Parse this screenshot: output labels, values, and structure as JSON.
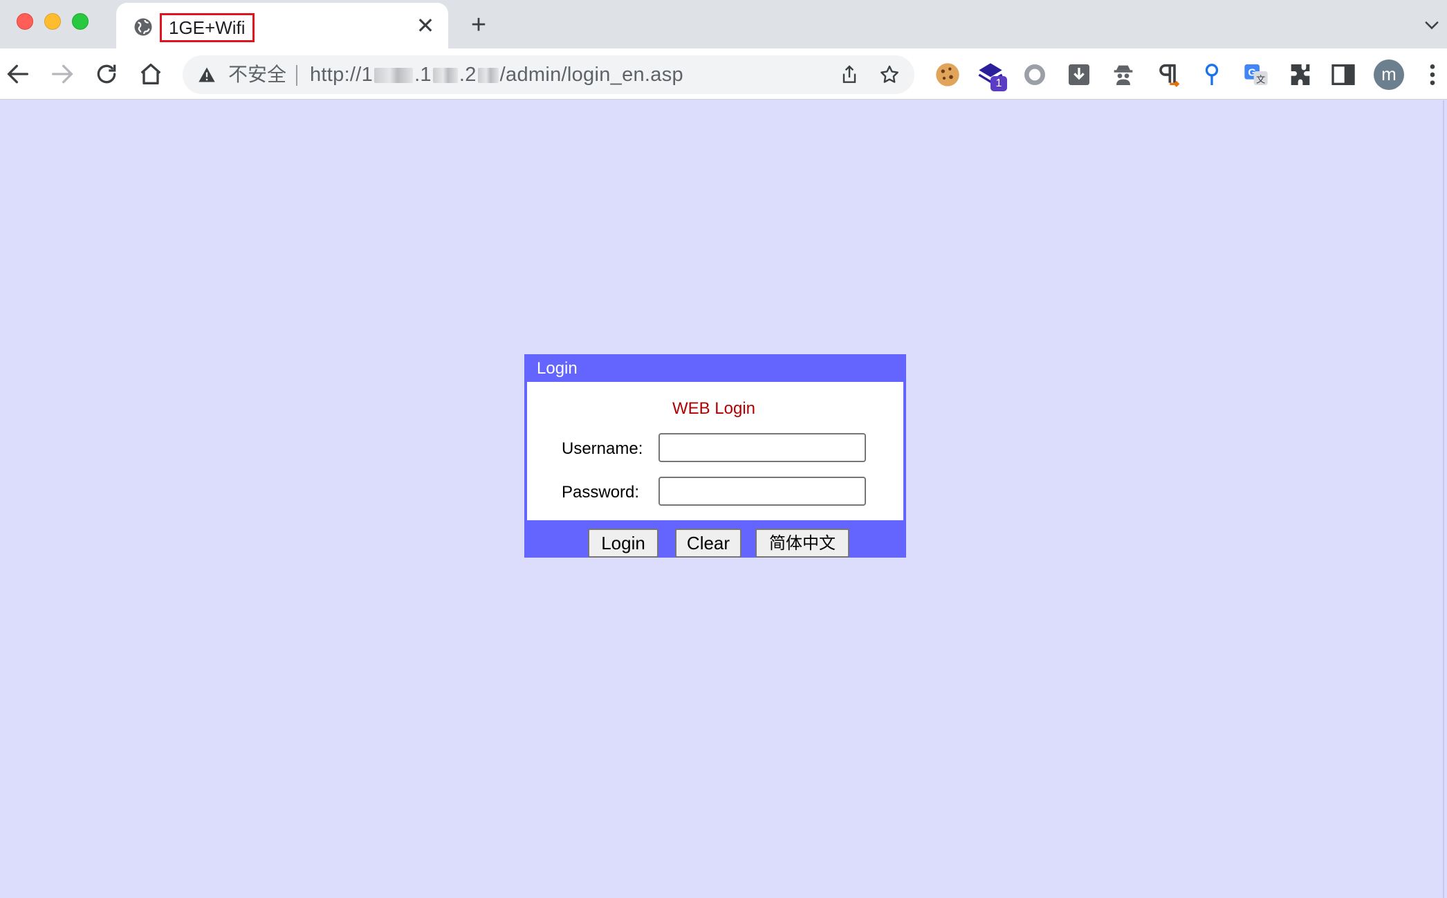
{
  "browser": {
    "tab": {
      "title": "1GE+Wifi",
      "close_glyph": "✕"
    },
    "new_tab_glyph": "+",
    "omnibox": {
      "security_label": "不安全",
      "url_prefix": "http://1",
      "url_part2": ".1",
      "url_part3": ".2",
      "url_suffix": "/admin/login_en.asp"
    },
    "extension_badge": "1",
    "avatar_initial": "m",
    "icons": {
      "back": "arrow-left-icon",
      "forward": "arrow-right-icon",
      "reload": "reload-icon",
      "home": "home-icon",
      "warning": "warning-icon",
      "share": "share-icon",
      "bookmark": "star-icon",
      "menu": "more-vert-icon"
    }
  },
  "login": {
    "header": "Login",
    "heading": "WEB Login",
    "username_label": "Username:",
    "password_label": "Password:",
    "username_value": "",
    "password_value": "",
    "buttons": {
      "login": "Login",
      "clear": "Clear",
      "language": "简体中文"
    }
  },
  "colors": {
    "page_background": "#dcdcfd",
    "panel_border": "#6464ff",
    "heading_text": "#b00000",
    "tab_highlight": "#e0141e"
  }
}
